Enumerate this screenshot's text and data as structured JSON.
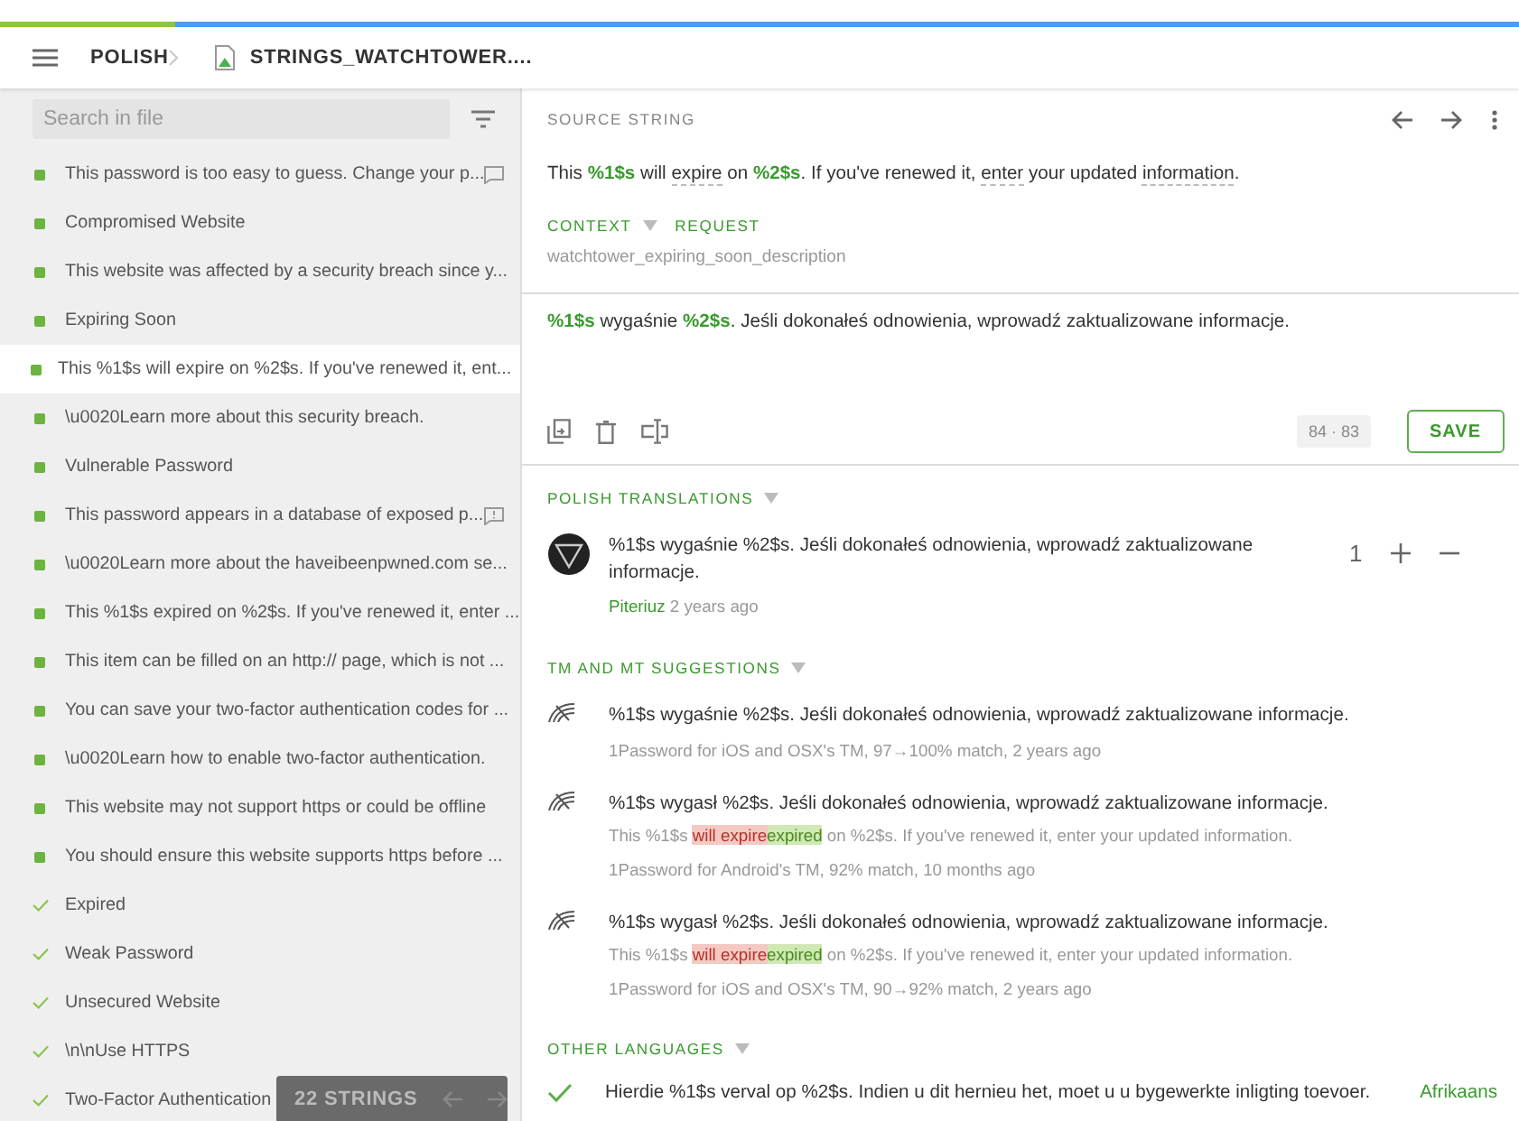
{
  "progress": {
    "level": 0.115
  },
  "breadcrumb": [
    {
      "label": "POLISH",
      "kind": "language"
    },
    {
      "label": "STRINGS_WATCHTOWER....",
      "kind": "file"
    }
  ],
  "search": {
    "placeholder": "Search in file"
  },
  "strings": [
    {
      "text": "This password is too easy to guess. Change your p...",
      "approved": false,
      "selected": false,
      "comment": true
    },
    {
      "text": "Compromised Website",
      "approved": false,
      "selected": false
    },
    {
      "text": "This website was affected by a security breach since y...",
      "approved": false,
      "selected": false
    },
    {
      "text": "Expiring Soon",
      "approved": false,
      "selected": false
    },
    {
      "text": "This %1$s will expire on %2$s. If you've renewed it, ent...",
      "approved": false,
      "selected": true
    },
    {
      "text": "\\u0020Learn more about this security breach.",
      "approved": false,
      "selected": false
    },
    {
      "text": "Vulnerable Password",
      "approved": false,
      "selected": false
    },
    {
      "text": "This password appears in a database of exposed p...",
      "approved": false,
      "selected": false,
      "issue": true
    },
    {
      "text": "\\u0020Learn more about the haveibeenpwned.com se...",
      "approved": false,
      "selected": false
    },
    {
      "text": "This %1$s expired on %2$s. If you've renewed it, enter ...",
      "approved": false,
      "selected": false
    },
    {
      "text": "This item can be filled on an http:// page, which is not ...",
      "approved": false,
      "selected": false
    },
    {
      "text": "You can save your two-factor authentication codes for ...",
      "approved": false,
      "selected": false
    },
    {
      "text": "\\u0020Learn how to enable two-factor authentication.",
      "approved": false,
      "selected": false
    },
    {
      "text": "This website may not support https or could be offline",
      "approved": false,
      "selected": false
    },
    {
      "text": "You should ensure this website supports https before ...",
      "approved": false,
      "selected": false
    },
    {
      "text": "Expired",
      "approved": true,
      "selected": false
    },
    {
      "text": "Weak Password",
      "approved": true,
      "selected": false
    },
    {
      "text": "Unsecured Website",
      "approved": true,
      "selected": false
    },
    {
      "text": "\\n\\nUse HTTPS",
      "approved": true,
      "selected": false
    },
    {
      "text": "Two-Factor Authentication",
      "approved": true,
      "selected": false
    }
  ],
  "string_count": "22 STRINGS",
  "source": {
    "label": "SOURCE STRING",
    "segments": [
      {
        "text": "This "
      },
      {
        "text": "%1$s",
        "kind": "placeholder"
      },
      {
        "text": " will "
      },
      {
        "text": "expire",
        "kind": "term"
      },
      {
        "text": " on "
      },
      {
        "text": "%2$s",
        "kind": "placeholder"
      },
      {
        "text": ". If you've renewed it, "
      },
      {
        "text": "enter",
        "kind": "term"
      },
      {
        "text": " your updated "
      },
      {
        "text": "information",
        "kind": "term"
      },
      {
        "text": "."
      }
    ],
    "context_label": "CONTEXT",
    "request_label": "REQUEST",
    "key": "watchtower_expiring_soon_description"
  },
  "editor": {
    "segments": [
      {
        "text": "%1$s",
        "kind": "placeholder"
      },
      {
        "text": " wygaśnie "
      },
      {
        "text": "%2$s",
        "kind": "placeholder"
      },
      {
        "text": ". Jeśli dokonałeś odnowienia, wprowadź zaktualizowane informacje."
      }
    ],
    "counter": "84 · 83",
    "save": "SAVE"
  },
  "translations": {
    "title": "POLISH TRANSLATIONS",
    "items": [
      {
        "text": "%1$s wygaśnie %2$s. Jeśli dokonałeś odnowienia, wprowadź zaktualizowane informacje.",
        "author": "Piteriuz",
        "time": "2 years ago",
        "votes": "1"
      }
    ]
  },
  "suggestions": {
    "title": "TM AND MT SUGGESTIONS",
    "items": [
      {
        "text": "%1$s wygaśnie %2$s. Jeśli dokonałeś odnowienia, wprowadź zaktualizowane informacje.",
        "meta": "1Password for iOS and OSX's TM, 97→100% match, 2 years ago"
      },
      {
        "text": "%1$s wygasł %2$s. Jeśli dokonałeś odnowienia, wprowadź zaktualizowane informacje.",
        "diff": [
          {
            "text": "This %1$s "
          },
          {
            "text": "will expire",
            "kind": "removed"
          },
          {
            "text": "expired",
            "kind": "added"
          },
          {
            "text": " on %2$s. If you've renewed it, enter your updated information."
          }
        ],
        "meta": "1Password for Android's TM, 92% match, 10 months ago"
      },
      {
        "text": "%1$s wygasł %2$s. Jeśli dokonałeś odnowienia, wprowadź zaktualizowane informacje.",
        "diff": [
          {
            "text": "This %1$s "
          },
          {
            "text": "will expire",
            "kind": "removed"
          },
          {
            "text": "expired",
            "kind": "added"
          },
          {
            "text": " on %2$s. If you've renewed it, enter your updated information."
          }
        ],
        "meta": "1Password for iOS and OSX's TM, 90→92% match, 2 years ago"
      }
    ]
  },
  "other_languages": {
    "title": "OTHER LANGUAGES",
    "items": [
      {
        "text": "Hierdie %1$s verval op %2$s. Indien u dit hernieu het, moet u u bygewerkte inligting toevoer.",
        "approved": true,
        "language": "Afrikaans"
      }
    ]
  }
}
